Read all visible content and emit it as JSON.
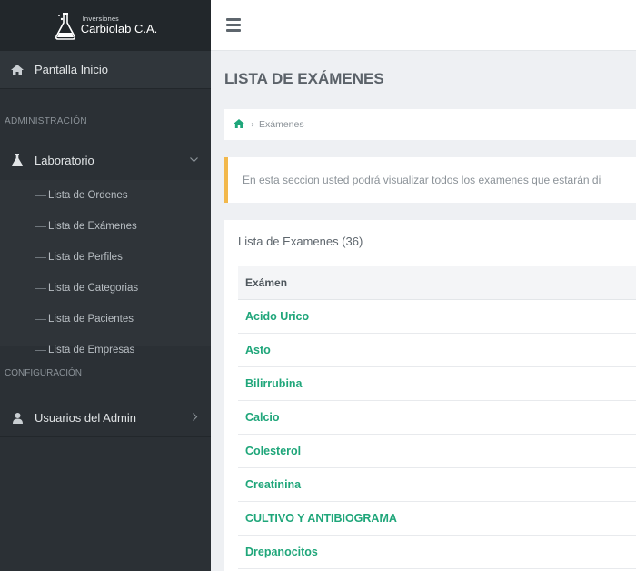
{
  "brand": {
    "small": "Inversiones",
    "name": "Carbiolab C.A."
  },
  "sidebar": {
    "home": "Pantalla Inicio",
    "admin_section": "ADMINISTRACIÓN",
    "lab_group": "Laboratorio",
    "lab_items": [
      {
        "label": "Lista de Ordenes"
      },
      {
        "label": "Lista de Exámenes"
      },
      {
        "label": "Lista de Perfiles"
      },
      {
        "label": "Lista de Categorias"
      },
      {
        "label": "Lista de Pacientes"
      },
      {
        "label": "Lista de Empresas"
      }
    ],
    "config_section": "CONFIGURACIÓN",
    "users": "Usuarios del Admin"
  },
  "main": {
    "title": "LISTA DE EXÁMENES",
    "breadcrumb": "Exámenes",
    "alert": "En esta seccion usted podrá visualizar todos los examenes que estarán di",
    "panel_title": "Lista de Examenes (36)",
    "table_header": "Exámen",
    "rows": [
      "Acido Urico",
      "Asto",
      "Bilirrubina",
      "Calcio",
      "Colesterol",
      "Creatinina",
      "CULTIVO Y ANTIBIOGRAMA",
      "Drepanocitos"
    ]
  },
  "colors": {
    "accent": "#1fa67a",
    "sidebar": "#2b3035",
    "alert_border": "#f2b84b"
  }
}
